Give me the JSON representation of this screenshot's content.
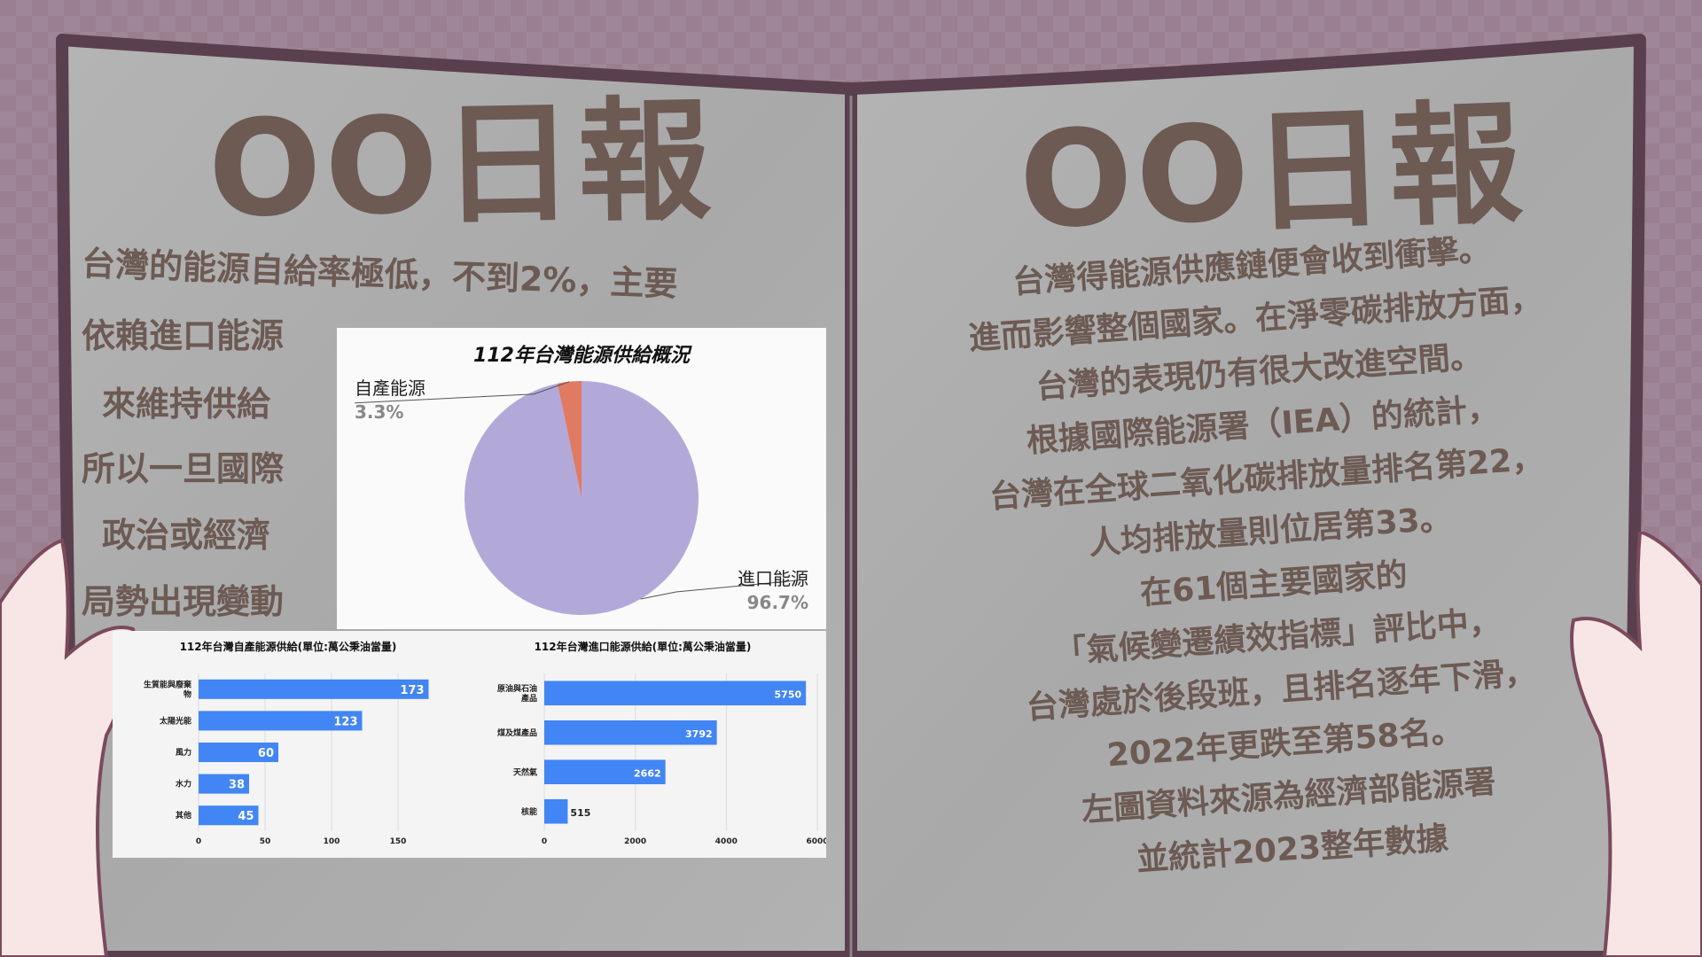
{
  "left_masthead": "OO日報",
  "right_masthead": "OO日報",
  "left_text": [
    "台灣的能源自給率極低，不到2%，主要",
    "依賴進口能源",
    "來維持供給",
    "所以一旦國際",
    "政治或經濟",
    "局勢出現變動"
  ],
  "right_text": [
    "台灣得能源供應鏈便會收到衝擊。",
    "進而影響整個國家。在淨零碳排放方面，",
    "台灣的表現仍有很大改進空間。",
    "根據國際能源署（IEA）的統計，",
    "台灣在全球二氧化碳排放量排名第22，",
    "人均排放量則位居第33。",
    "在61個主要國家的",
    "「氣候變遷績效指標」評比中，",
    "台灣處於後段班，且排名逐年下滑，",
    "2022年更跌至第58名。",
    "左圖資料來源為經濟部能源署",
    "並統計2023整年數據"
  ],
  "colors": {
    "background": "#9a7f90",
    "paper": "#aeaeae",
    "ink": "#6c5a53",
    "pie_import": "#b3a9d9",
    "pie_domestic": "#e07a63",
    "bar": "#4285f4"
  },
  "chart_data": [
    {
      "type": "pie",
      "title": "112年台灣能源供給概況",
      "slices": [
        {
          "label": "自產能源",
          "value": 3.3,
          "value_label": "3.3%",
          "color": "#e07a63"
        },
        {
          "label": "進口能源",
          "value": 96.7,
          "value_label": "96.7%",
          "color": "#b3a9d9"
        }
      ]
    },
    {
      "type": "bar",
      "orientation": "horizontal",
      "title": "112年台灣自產能源供給(單位:萬公秉油當量)",
      "categories": [
        "生質能與廢棄物",
        "太陽光能",
        "風力",
        "水力",
        "其他"
      ],
      "values": [
        173,
        123,
        60,
        38,
        45
      ],
      "xlim": [
        0,
        200
      ],
      "xticks": [
        0,
        50,
        100,
        150
      ],
      "color": "#4285f4"
    },
    {
      "type": "bar",
      "orientation": "horizontal",
      "title": "112年台灣進口能源供給(單位:萬公秉油當量)",
      "categories": [
        "原油與石油產品",
        "煤及煤產品",
        "天然氣",
        "核能"
      ],
      "values": [
        5750,
        3792,
        2662,
        515
      ],
      "xlim": [
        0,
        6000
      ],
      "xticks": [
        0,
        2000,
        4000,
        6000
      ],
      "color": "#4285f4"
    }
  ]
}
